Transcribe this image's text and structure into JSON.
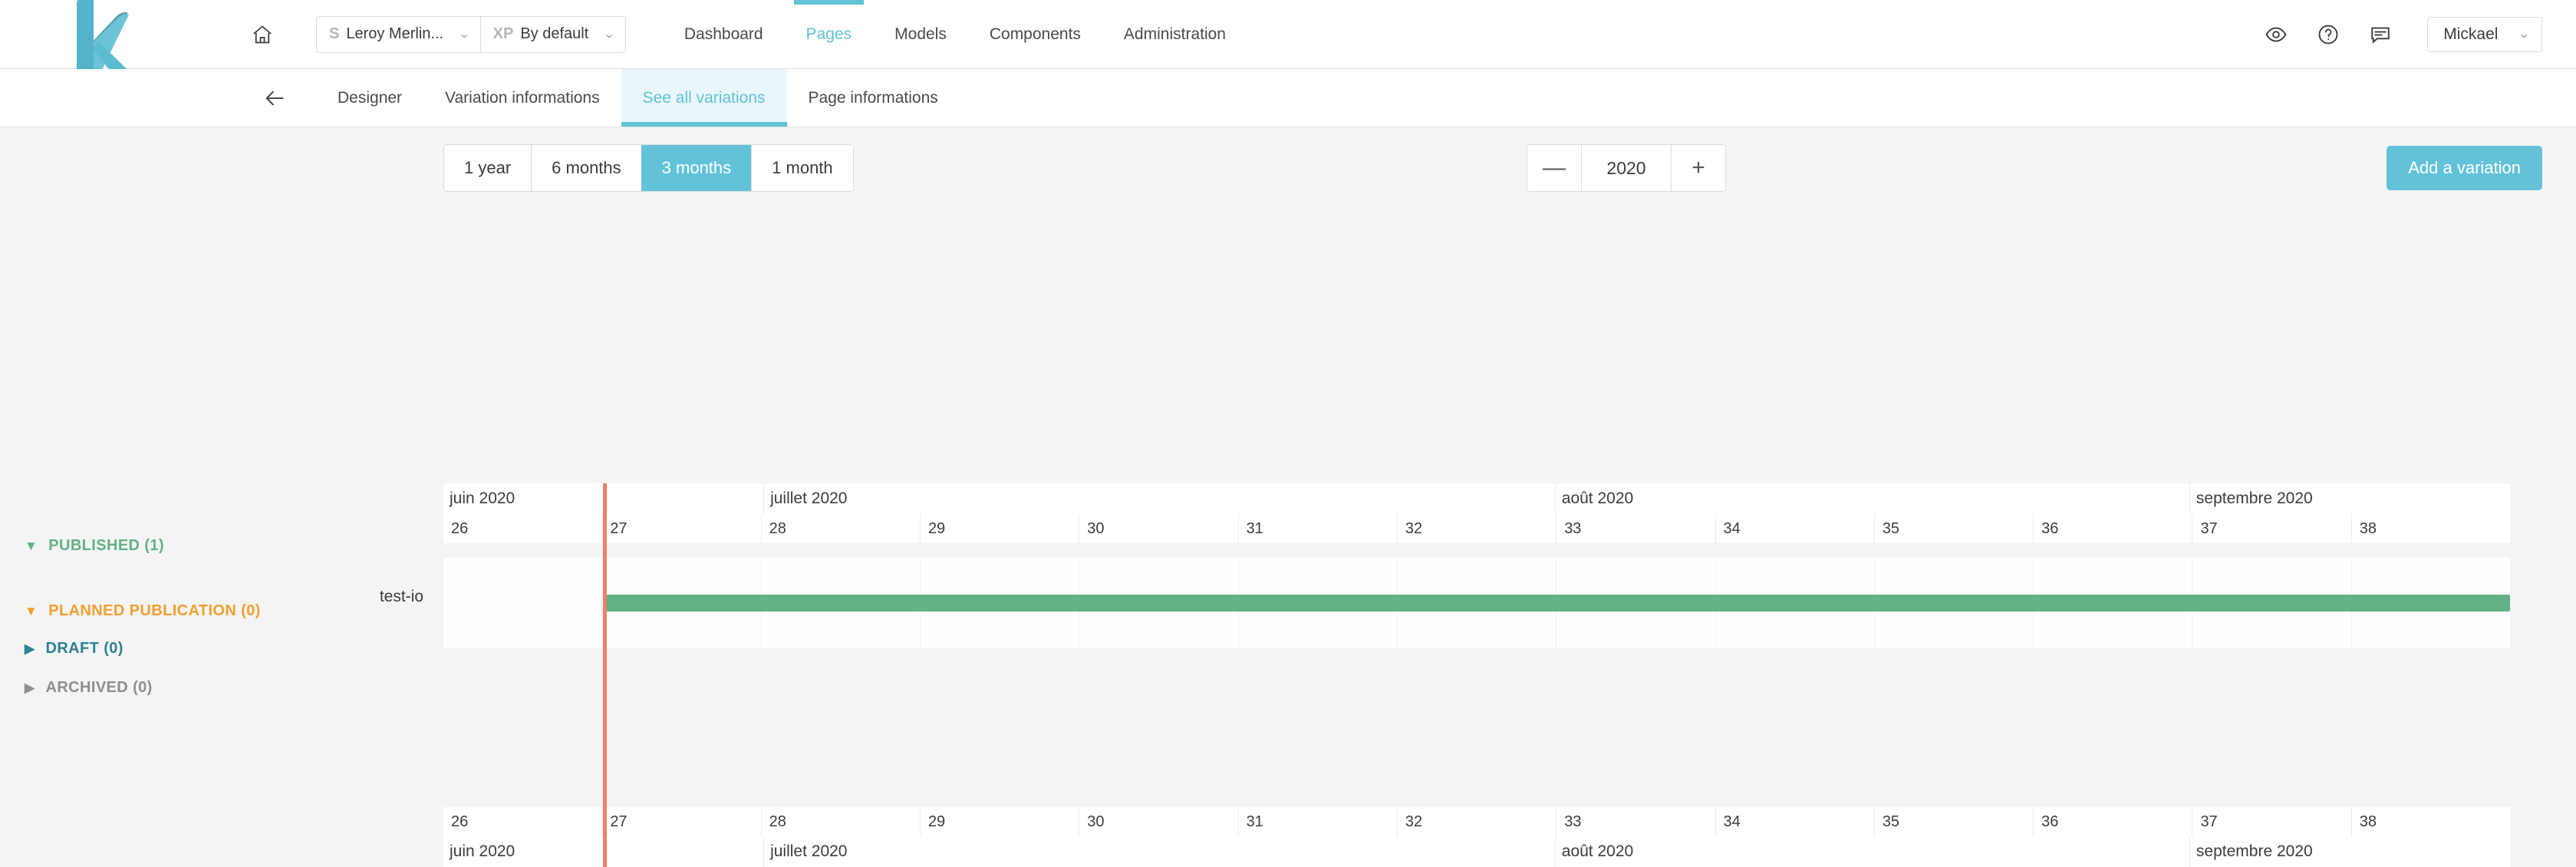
{
  "brand": {
    "logo_name": "kameleoon-k-logo",
    "accent": "#62c2d8"
  },
  "topbar": {
    "home_icon": "home-icon",
    "context": {
      "site": {
        "prefix": "S",
        "label": "Leroy Merlin..."
      },
      "experiment": {
        "prefix": "XP",
        "label": "By default"
      }
    },
    "nav": [
      {
        "label": "Dashboard",
        "active": false
      },
      {
        "label": "Pages",
        "active": true
      },
      {
        "label": "Models",
        "active": false
      },
      {
        "label": "Components",
        "active": false
      },
      {
        "label": "Administration",
        "active": false
      }
    ],
    "actions": [
      {
        "icon": "eye-icon"
      },
      {
        "icon": "help-circle-icon"
      },
      {
        "icon": "comment-icon"
      }
    ],
    "user": {
      "name": "Mickael",
      "caret": "chevron-down-icon"
    }
  },
  "subnav": {
    "back_icon": "arrow-left-icon",
    "items": [
      {
        "label": "Designer",
        "active": false
      },
      {
        "label": "Variation informations",
        "active": false
      },
      {
        "label": "See all variations",
        "active": true
      },
      {
        "label": "Page informations",
        "active": false
      }
    ]
  },
  "toolbar": {
    "ranges": [
      {
        "label": "1 year",
        "active": false
      },
      {
        "label": "6 months",
        "active": false
      },
      {
        "label": "3 months",
        "active": true
      },
      {
        "label": "1 month",
        "active": false
      }
    ],
    "year": {
      "minus": "—",
      "value": "2020",
      "plus": "+"
    },
    "add_label": "Add a variation"
  },
  "groups": [
    {
      "id": "published",
      "label": "PUBLISHED (1)",
      "expanded": true,
      "color": "#63b185",
      "triangle": "▼"
    },
    {
      "id": "planned",
      "label": "PLANNED PUBLICATION (0)",
      "expanded": true,
      "color": "#f0a030",
      "triangle": "▼"
    },
    {
      "id": "draft",
      "label": "DRAFT (0)",
      "expanded": false,
      "color": "#2d8294",
      "triangle": "▶"
    },
    {
      "id": "archived",
      "label": "ARCHIVED (0)",
      "expanded": false,
      "color": "#8e8e8e",
      "triangle": "▶"
    }
  ],
  "chart_data": {
    "type": "gantt",
    "title": "",
    "months": [
      {
        "label": "juin 2020",
        "weeks": 2
      },
      {
        "label": "juillet 2020",
        "weeks": 5
      },
      {
        "label": "août 2020",
        "weeks": 4
      },
      {
        "label": "septembre 2020",
        "weeks": 2
      }
    ],
    "weeks": [
      "26",
      "27",
      "28",
      "29",
      "30",
      "31",
      "32",
      "33",
      "34",
      "35",
      "36",
      "37",
      "38"
    ],
    "today_marker": {
      "label": "",
      "week_index": 1,
      "color": "#ef7f66"
    },
    "tasks": [
      {
        "name": "test-io",
        "group": "published",
        "start_week": "27",
        "end_week": "38",
        "open_ended": true,
        "color": "#63b185"
      }
    ]
  }
}
